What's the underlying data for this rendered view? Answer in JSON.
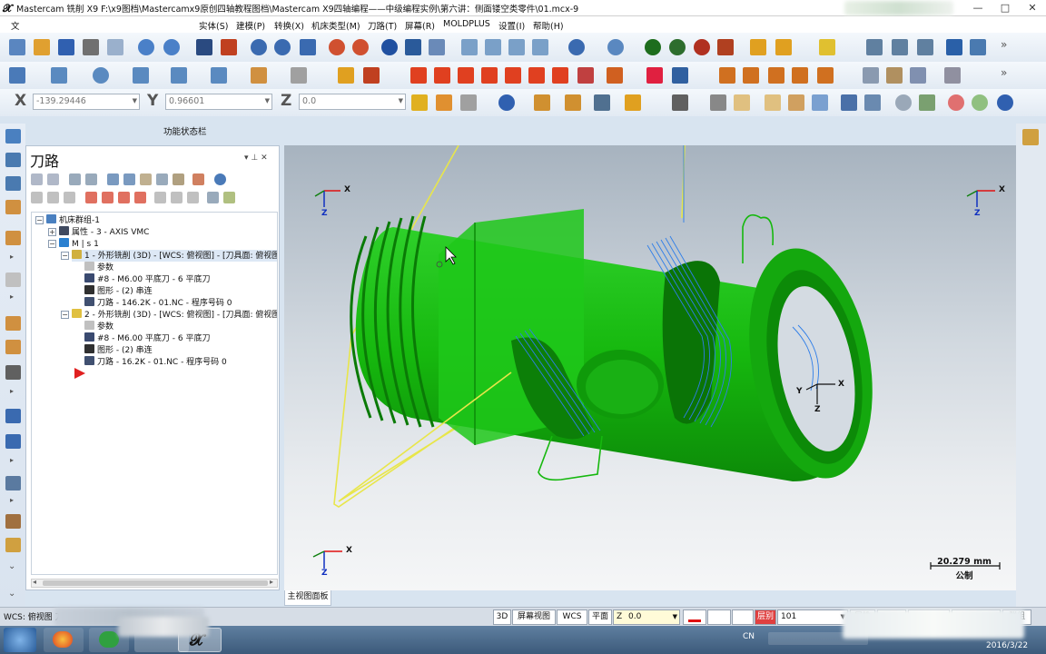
{
  "window": {
    "title": "Mastercam 铣削 X9  F:\\x9图档\\Mastercamx9原创四轴教程图档\\Mastercam X9四轴编程——中级编程实例\\第六讲：侧面镂空类零件\\01.mcx-9",
    "controls": [
      "—",
      "□",
      "✕"
    ]
  },
  "menu": [
    "文",
    "实体(S)",
    "建模(P)",
    "转换(X)",
    "机床类型(M)",
    "刀路(T)",
    "屏幕(R)",
    "MOLDPLUS",
    "设置(I)",
    "帮助(H)"
  ],
  "coords": {
    "x_label": "X",
    "x_value": "-139.29446",
    "y_label": "Y",
    "y_value": "0.96601",
    "z_label": "Z",
    "z_value": "0.0"
  },
  "function_status": "功能状态栏",
  "panel": {
    "title": "刀路",
    "pin": "▾  ⊥  ✕",
    "tree": [
      {
        "text": "机床群组-1",
        "depth": 0,
        "icon": "machine-group-icon",
        "expander": "−"
      },
      {
        "text": "属性 - 3 - AXIS VMC",
        "depth": 1,
        "icon": "properties-icon",
        "expander": "+"
      },
      {
        "text": "M | s 1",
        "depth": 1,
        "icon": "toolpath-group-icon",
        "expander": "−"
      },
      {
        "text": "1 - 外形铣削 (3D) - [WCS: 俯视图] - [刀具面: 俯视图",
        "depth": 2,
        "icon": "operation-folder-icon",
        "expander": "−",
        "selected": true
      },
      {
        "text": "参数",
        "depth": 3,
        "icon": "parameters-icon"
      },
      {
        "text": "#8 - M6.00 平底刀 - 6 平底刀",
        "depth": 3,
        "icon": "tool-icon"
      },
      {
        "text": "图形 - (2) 串连",
        "depth": 3,
        "icon": "geometry-icon"
      },
      {
        "text": "刀路 - 146.2K - 01.NC - 程序号码 0",
        "depth": 3,
        "icon": "toolpath-icon"
      },
      {
        "text": "2 - 外形铣削 (3D) - [WCS: 俯视图] - [刀具面: 俯视图",
        "depth": 2,
        "icon": "operation-folder-icon",
        "expander": "−"
      },
      {
        "text": "参数",
        "depth": 3,
        "icon": "parameters-icon"
      },
      {
        "text": "#8 - M6.00 平底刀 - 6 平底刀",
        "depth": 3,
        "icon": "tool-icon"
      },
      {
        "text": "图形 - (2) 串连",
        "depth": 3,
        "icon": "geometry-icon"
      },
      {
        "text": "刀路 - 16.2K - 01.NC - 程序号码 0",
        "depth": 3,
        "icon": "toolpath-icon"
      },
      {
        "text": "",
        "depth": 2,
        "icon": "insert-arrow-icon"
      }
    ]
  },
  "viewport": {
    "tab": "主视图面板",
    "scale_value": "20.279 mm",
    "scale_unit": "公制",
    "axis": {
      "x": "X",
      "y": "Y",
      "z": "Z"
    }
  },
  "statusbar": {
    "left_text": "WCS: 俯视图  刀具: 俯视图  俯视图",
    "btn_3d": "3D",
    "screen_view": "屏幕视图",
    "wcs": "WCS",
    "plane": "平面",
    "z_label": "Z",
    "z_value": "0.0",
    "level_label": "层别",
    "level_value": "101",
    "attr_label": "属性",
    "group_label": "群组"
  },
  "taskbar": {
    "lang": "CN",
    "date": "2016/3/22"
  },
  "colors": {
    "part_green": "#16b80e",
    "toolpath_blue": "#2f7ee8",
    "wire_yellow": "#e8e64a",
    "axis_red": "#e01010",
    "axis_green": "#108010",
    "axis_blue": "#1030c0"
  }
}
